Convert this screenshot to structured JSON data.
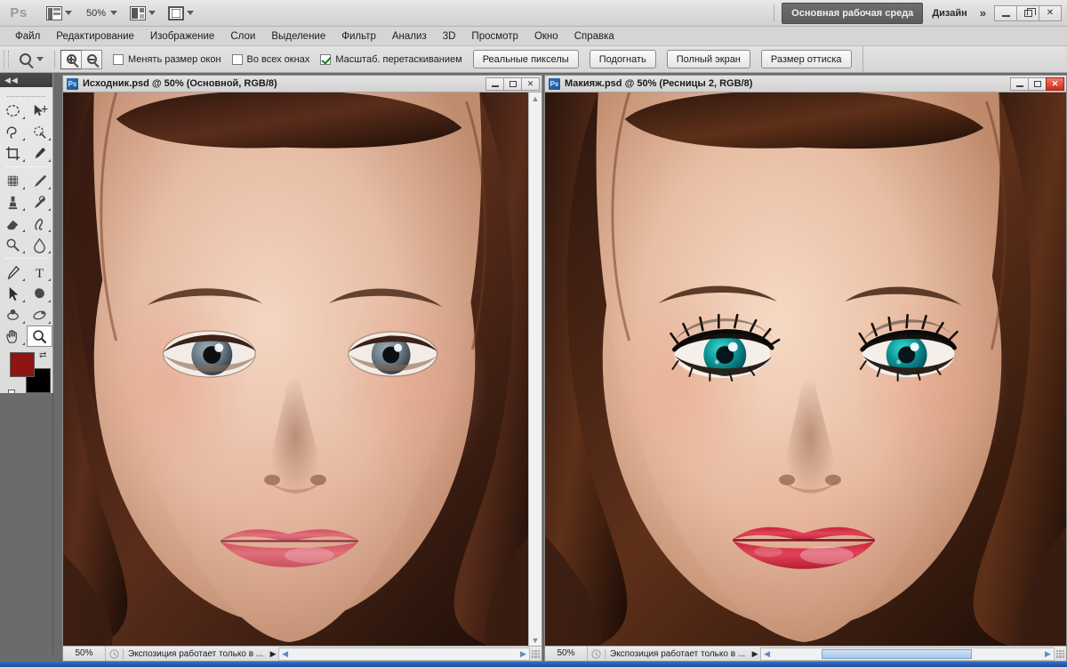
{
  "app": {
    "logo": "Ps",
    "zoom_level": "50%"
  },
  "titlebar": {
    "icons": [
      "screen-mode-icon",
      "zoom-dropdown",
      "arrange-documents-icon",
      "screen-mode-cycle-icon"
    ],
    "workspace_active": "Основная рабочая среда",
    "workspace_other": "Дизайн",
    "more_label": "»",
    "window_controls": [
      "minimize",
      "restore",
      "close"
    ]
  },
  "menubar": {
    "items": [
      "Файл",
      "Редактирование",
      "Изображение",
      "Слои",
      "Выделение",
      "Фильтр",
      "Анализ",
      "3D",
      "Просмотр",
      "Окно",
      "Справка"
    ]
  },
  "optionsbar": {
    "tool_icon": "zoom-tool-icon",
    "zoom_in_label": "zoom-in-icon",
    "zoom_out_label": "zoom-out-icon",
    "checkboxes": [
      {
        "label": "Менять размер окон",
        "checked": false
      },
      {
        "label": "Во всех окнах",
        "checked": false
      },
      {
        "label": "Масштаб. перетаскиванием",
        "checked": true
      }
    ],
    "buttons": [
      "Реальные пикселы",
      "Подогнать",
      "Полный экран",
      "Размер оттиска"
    ]
  },
  "toolbox": {
    "collapse_label": "◀◀",
    "tools": [
      "marquee-elliptical-tool",
      "move-tool",
      "lasso-tool",
      "quick-selection-tool",
      "crop-tool",
      "eyedropper-tool",
      "patch-tool",
      "brush-tool",
      "clone-stamp-tool",
      "history-brush-tool",
      "eraser-tool",
      "smudge-tool",
      "dodge-tool",
      "blur-tool",
      "pen-tool",
      "type-tool",
      "path-selection-tool",
      "custom-shape-tool",
      "3d-rotate-tool",
      "3d-orbit-tool",
      "hand-tool",
      "zoom-tool"
    ],
    "selected_tool": "zoom-tool",
    "foreground_color": "#8e1512",
    "background_color": "#000000",
    "quick_mask_label": "quick-mask-icon"
  },
  "documents": [
    {
      "id": "source",
      "icon_label": "Ps",
      "title": "Исходник.psd @ 50% (Основной, RGB/8)",
      "active": false,
      "status_zoom": "50%",
      "status_message": "Экспозиция работает только в ...",
      "has_vertical_scrollbar": true,
      "close_is_red": false,
      "variant": "natural"
    },
    {
      "id": "makeup",
      "icon_label": "Ps",
      "title": "Макияж.psd @ 50% (Ресницы 2, RGB/8)",
      "active": true,
      "status_zoom": "50%",
      "status_message": "Экспозиция работает только в ...",
      "has_vertical_scrollbar": false,
      "close_is_red": true,
      "variant": "makeup"
    }
  ],
  "colors": {
    "accent_blue": "#2f6fc4",
    "chrome_gray": "#d5d5d5",
    "canvas_gray": "#6b6b6b",
    "iris_natural": "#6d7d86",
    "iris_makeup": "#0e8a8a",
    "lips_natural": "#d9606a",
    "lips_makeup": "#d62f4a",
    "skin_base": "#e8c0a6",
    "hair": "#4a2418"
  }
}
